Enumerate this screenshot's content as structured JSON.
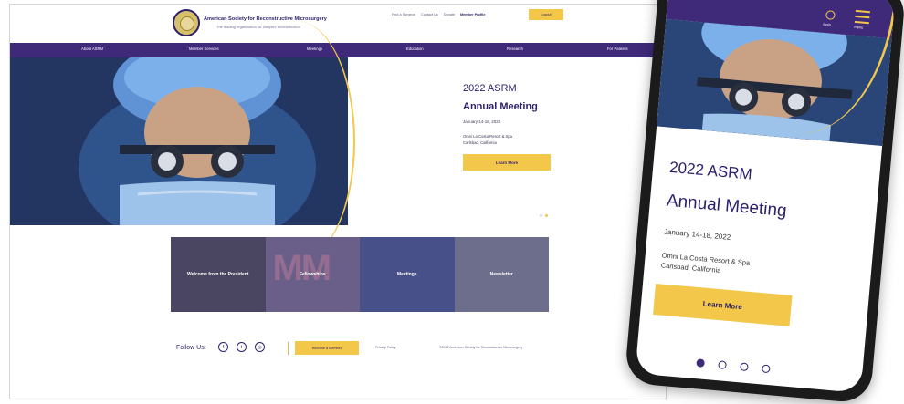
{
  "desktop": {
    "site_name": "American Society for Reconstructive Microsurgery",
    "tagline": "The leading organization for complex reconstruction",
    "top_links": {
      "find_surgeon": "Find a Surgeon",
      "contact": "Contact Us",
      "donate": "Donate",
      "member_profile": "Member Profile",
      "logout": "Logout"
    },
    "nav": [
      "About ASRM",
      "Member Services",
      "Meetings",
      "Education",
      "Research",
      "For Patients"
    ],
    "hero": {
      "title_line1": "2022 ASRM",
      "title_line2": "Annual Meeting",
      "date": "January 14-18, 2022",
      "location_line1": "Omni La Costa Resort & Spa",
      "location_line2": "Carlsbad, California",
      "button": "Learn More",
      "active_slide": 1,
      "slide_count": 2
    },
    "tiles": [
      {
        "label": "Welcome from the President",
        "bg": "#4a4560"
      },
      {
        "label": "Fellowships",
        "bg": "#6a5f88",
        "overlay": "MM"
      },
      {
        "label": "Meetings",
        "bg": "#48508a"
      },
      {
        "label": "Newsletter",
        "bg": "#6d6d8c"
      }
    ],
    "footer": {
      "follow": "Follow Us:",
      "social_icons": [
        "facebook-icon",
        "twitter-icon",
        "instagram-icon"
      ],
      "social_glyphs": [
        "f",
        "t",
        "◎"
      ],
      "become_member": "Become a Member",
      "privacy": "Privacy Policy",
      "copyright": "©2022 American Society for Reconstructive Microsurgery"
    }
  },
  "mobile": {
    "login_label": "login",
    "menu_label": "menu",
    "hero": {
      "title_line1": "2022 ASRM",
      "title_line2": "Annual Meeting",
      "date": "January 14-18, 2022",
      "location_line1": "Omni La Costa Resort & Spa",
      "location_line2": "Carlsbad, California",
      "button": "Learn More",
      "active_slide": 0,
      "slide_count": 4
    }
  },
  "colors": {
    "brand_purple": "#3f2a7a",
    "accent_gold": "#f2c74a",
    "text_dark": "#2d1f6a"
  }
}
